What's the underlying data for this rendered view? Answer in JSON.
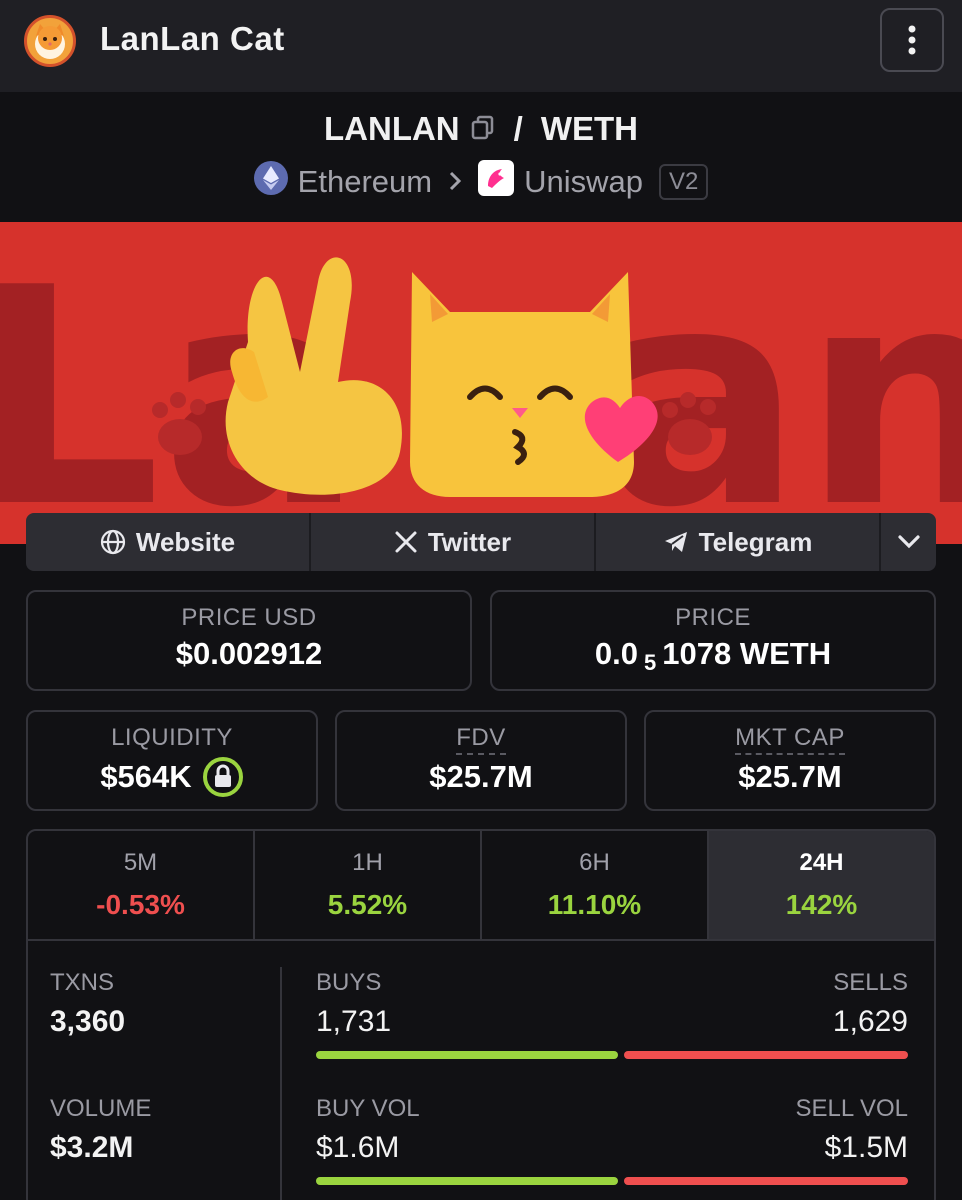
{
  "app": {
    "title": "LanLan Cat"
  },
  "pair": {
    "base": "LANLAN",
    "quote": "WETH",
    "separator": "/",
    "chain": "Ethereum",
    "dex": "Uniswap",
    "version": "V2"
  },
  "links": [
    {
      "label": "Website",
      "icon": "globe-icon"
    },
    {
      "label": "Twitter",
      "icon": "x-logo-icon"
    },
    {
      "label": "Telegram",
      "icon": "telegram-icon"
    }
  ],
  "stats": {
    "price_usd": {
      "label": "PRICE USD",
      "value": "$0.002912"
    },
    "price": {
      "label": "PRICE",
      "prefix": "0.0",
      "sub": "5",
      "suffix": "1078 WETH"
    },
    "liquidity": {
      "label": "LIQUIDITY",
      "value": "$564K"
    },
    "fdv": {
      "label": "FDV",
      "value": "$25.7M"
    },
    "mkt_cap": {
      "label": "MKT CAP",
      "value": "$25.7M"
    }
  },
  "timeframes": [
    {
      "label": "5M",
      "change": "-0.53%",
      "trend": "down"
    },
    {
      "label": "1H",
      "change": "5.52%",
      "trend": "up"
    },
    {
      "label": "6H",
      "change": "11.10%",
      "trend": "up"
    },
    {
      "label": "24H",
      "change": "142%",
      "trend": "up",
      "selected": true
    }
  ],
  "txns": {
    "txns_label": "TXNS",
    "txns_value": "3,360",
    "buys_label": "BUYS",
    "buys_value": "1,731",
    "sells_label": "SELLS",
    "sells_value": "1,629",
    "buy_ratio": 0.515,
    "volume_label": "VOLUME",
    "volume_value": "$3.2M",
    "buy_vol_label": "BUY VOL",
    "buy_vol_value": "$1.6M",
    "sell_vol_label": "SELL VOL",
    "sell_vol_value": "$1.5M",
    "buy_vol_ratio": 0.516
  },
  "colors": {
    "positive": "#9ad43f",
    "negative": "#ef4f4f",
    "banner": "#d6322c"
  }
}
